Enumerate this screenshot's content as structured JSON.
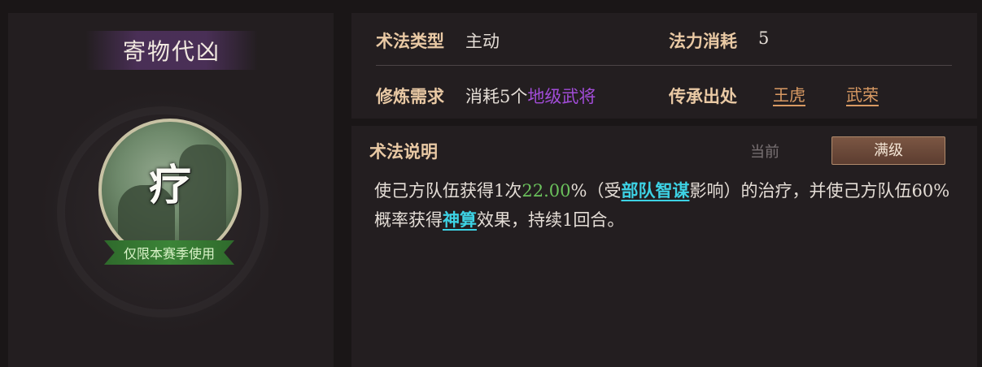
{
  "skill": {
    "name": "寄物代凶",
    "icon_glyph": "疗",
    "icon_name": "healing-tactic-icon",
    "season_tag": "仅限本赛季使用"
  },
  "info": {
    "type_label": "术法类型",
    "type_value": "主动",
    "cost_label": "法力消耗",
    "cost_value": "5",
    "req_label": "修炼需求",
    "req_prefix": "消耗5个",
    "req_highlight": "地级武将",
    "source_label": "传承出处",
    "sources": [
      "王虎",
      "武荣"
    ]
  },
  "description": {
    "title": "术法说明",
    "tab_current": "当前",
    "tab_max": "满级",
    "text_part1": "使己方队伍获得1次",
    "value": "22.00",
    "text_part2": "%（受",
    "keyword1": "部队智谋",
    "text_part3": "影响）的治疗，并使己方队伍60%概率获得",
    "keyword2": "神算",
    "text_part4": "效果，持续1回合。"
  },
  "colors": {
    "label": "#e9c9a4",
    "highlight_purple": "#a24cd8",
    "value_green": "#6bc15c",
    "keyword_cyan": "#3dd2e4",
    "link_orange": "#d99a63"
  }
}
